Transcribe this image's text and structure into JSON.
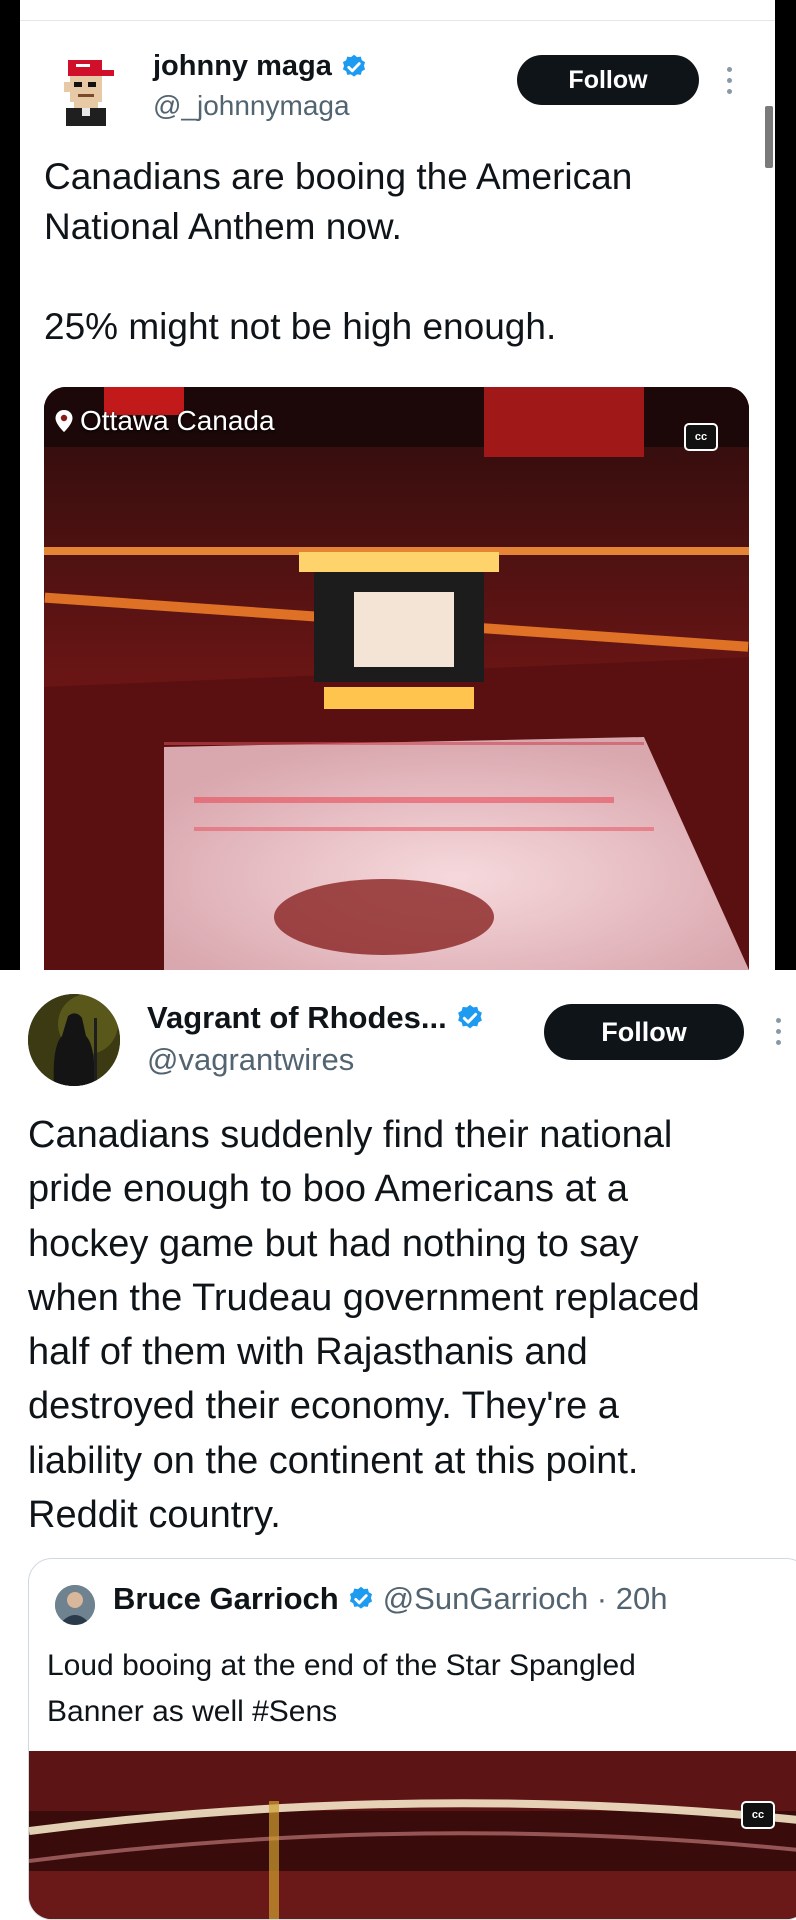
{
  "post1": {
    "display_name": "johnny maga",
    "handle": "@_johnnymaga",
    "follow_label": "Follow",
    "text_line1": "Canadians are booing the American",
    "text_line2": "National Anthem now.",
    "text_line3": "25% might not be high enough.",
    "location": "Ottawa Canada",
    "cc": "cc"
  },
  "post2": {
    "display_name": "Vagrant of Rhodes...",
    "handle": "@vagrantwires",
    "follow_label": "Follow",
    "lines": [
      "Canadians suddenly find their national",
      "pride enough to boo Americans at a",
      "hockey game but had nothing to say",
      "when the Trudeau government replaced",
      "half of them with Rajasthanis and",
      "destroyed their economy. They're a",
      "liability on the continent at this point.",
      "Reddit country."
    ]
  },
  "quoted": {
    "display_name": "Bruce Garrioch",
    "handle_time": "@SunGarrioch · 20h",
    "text_line1": "Loud booing at the end of the Star Spangled",
    "text_line2": "Banner as well #Sens",
    "cc": "cc"
  },
  "colors": {
    "verified": "#1d9bf0",
    "button_bg": "#0f1419",
    "text": "#0f1419",
    "secondary": "#536471"
  }
}
